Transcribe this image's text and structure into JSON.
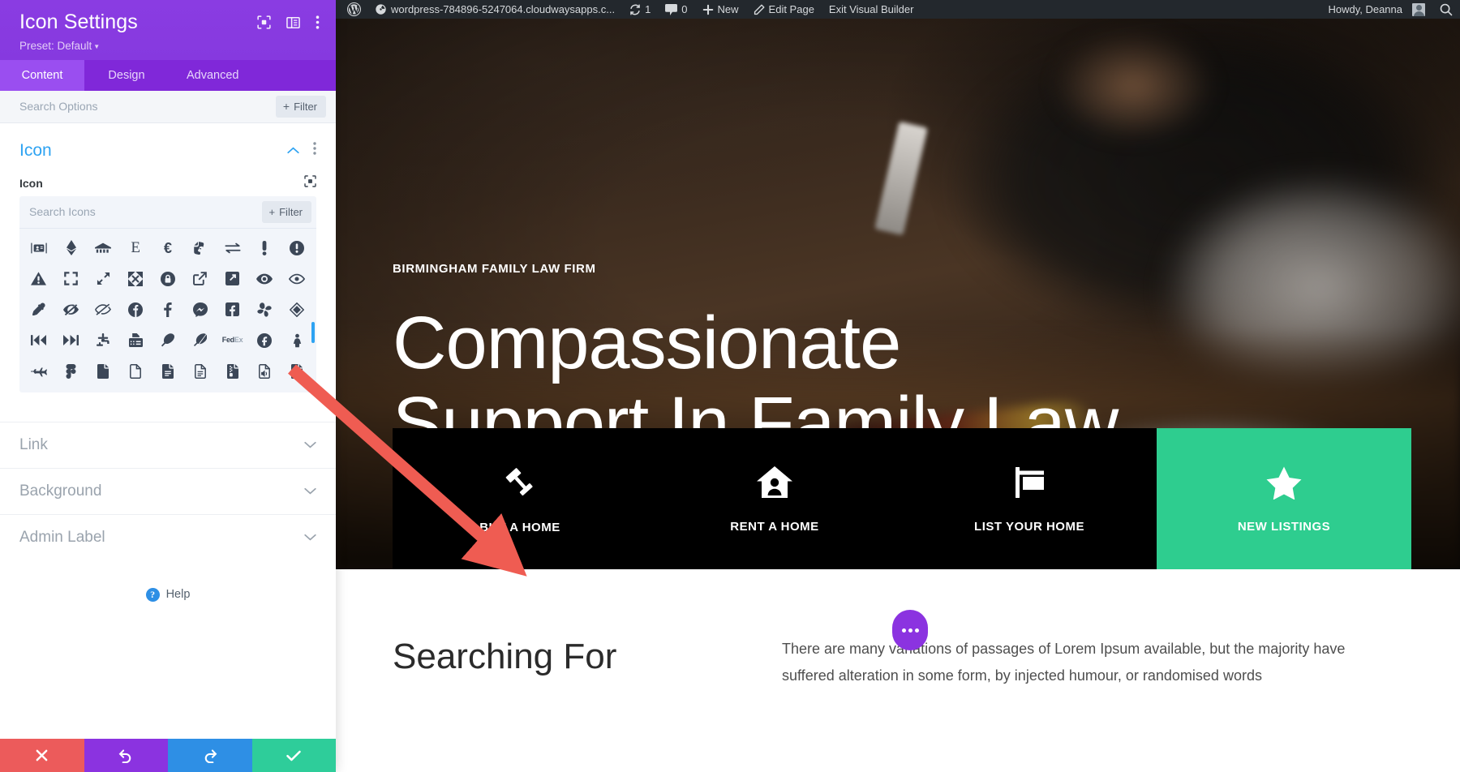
{
  "settings_panel": {
    "title": "Icon Settings",
    "preset_label": "Preset: Default",
    "header_icons": [
      "target-icon",
      "layout-panel-icon",
      "kebab-menu-icon"
    ],
    "tabs": [
      {
        "label": "Content",
        "active": true
      },
      {
        "label": "Design",
        "active": false
      },
      {
        "label": "Advanced",
        "active": false
      }
    ],
    "search": {
      "placeholder": "Search Options",
      "value": "",
      "filter_label": "Filter"
    },
    "icon_section": {
      "title": "Icon",
      "field_label": "Icon",
      "icon_search": {
        "placeholder": "Search Icons",
        "value": "",
        "filter_label": "Filter"
      },
      "icons": [
        "address-card-icon",
        "ethereum-icon",
        "etsy-icon",
        "encyclopedia-e-icon",
        "euro-sign-icon",
        "evernote-icon",
        "exchange-alt-icon",
        "exclamation-icon",
        "exclamation-circle-icon",
        "exclamation-triangle-icon",
        "expand-icon",
        "expand-alt-icon",
        "expand-arrows-icon",
        "expeditedssl-icon",
        "external-link-icon",
        "external-link-square-icon",
        "eye-icon",
        "eye-outline-icon",
        "eye-dropper-icon",
        "eye-slash-icon",
        "eye-slash-outline-icon",
        "facebook-circle-icon",
        "facebook-f-icon",
        "facebook-messenger-icon",
        "facebook-square-icon",
        "fan-icon",
        "fantasy-flight-games-icon",
        "fast-backward-icon",
        "fast-forward-icon",
        "faucet-icon",
        "fax-icon",
        "feather-icon",
        "feather-alt-icon",
        "fedex-icon",
        "fedora-icon",
        "female-icon",
        "fighter-jet-icon",
        "figma-icon",
        "file-icon",
        "file-outline-icon",
        "file-alt-icon",
        "file-alt-outline-icon",
        "file-archive-icon",
        "file-audio-icon",
        "file-audio-alt-icon"
      ],
      "selected_index": 0
    },
    "collapsed_sections": [
      {
        "label": "Link"
      },
      {
        "label": "Background"
      },
      {
        "label": "Admin Label"
      }
    ],
    "help_label": "Help",
    "footer_buttons": [
      {
        "name": "cancel",
        "icon": "close-icon",
        "color": "#ec5b5b"
      },
      {
        "name": "undo",
        "icon": "undo-icon",
        "color": "#8b33e0"
      },
      {
        "name": "redo",
        "icon": "redo-icon",
        "color": "#2e8fe5"
      },
      {
        "name": "save",
        "icon": "check-icon",
        "color": "#2ecd9a"
      }
    ]
  },
  "admin_bar": {
    "wordpress_logo": "wordpress-logo-icon",
    "site_name": "wordpress-784896-5247064.cloudwaysapps.c...",
    "updates_count": "1",
    "comments_count": "0",
    "new_label": "New",
    "edit_page_label": "Edit Page",
    "exit_builder_label": "Exit Visual Builder",
    "howdy_label": "Howdy, Deanna",
    "search_icon": "search-icon"
  },
  "hero": {
    "eyebrow": "BIRMINGHAM FAMILY LAW FIRM",
    "title_line1": "Compassionate",
    "title_line2": "Support In Family Law"
  },
  "cta_bar": {
    "accent_color": "#2ecd8f",
    "items": [
      {
        "label": "BUY A HOME",
        "icon": "gavel-icon",
        "accent": false
      },
      {
        "label": "RENT A HOME",
        "icon": "house-user-icon",
        "accent": false
      },
      {
        "label": "LIST YOUR HOME",
        "icon": "sign-post-icon",
        "accent": false
      },
      {
        "label": "NEW LISTINGS",
        "icon": "star-icon",
        "accent": true
      }
    ]
  },
  "lower_section": {
    "heading": "Searching For",
    "paragraph": "There are many variations of passages of Lorem Ipsum available, but the majority have suffered alteration in some form, by injected humour, or randomised words"
  },
  "floating_button": {
    "name": "page-settings-fab",
    "color": "#8b33e0"
  }
}
